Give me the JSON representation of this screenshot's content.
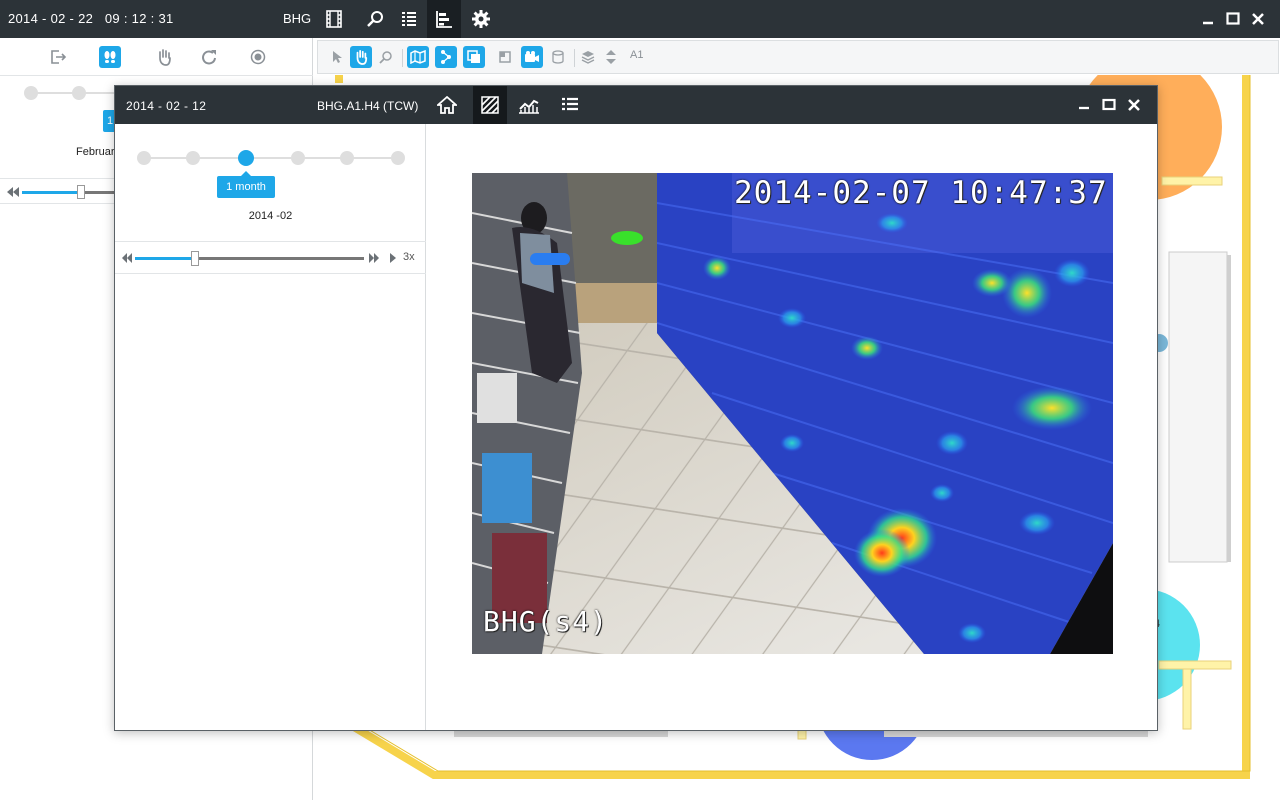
{
  "topbar": {
    "datetime": "2014 - 02 - 22   09 : 12 : 31",
    "site": "BHG",
    "icons": [
      "film-icon",
      "search-icon",
      "list-icon",
      "bar-chart-icon",
      "gear-icon"
    ],
    "window": [
      "minimize-icon",
      "maximize-icon",
      "close-icon"
    ]
  },
  "left_panel": {
    "tools": [
      "exit-icon",
      "footprints-icon",
      "hand-icon",
      "redo-icon",
      "record-icon"
    ],
    "badge_text": "1",
    "period_label": "Februar"
  },
  "map_toolbar": {
    "level_label": "A1"
  },
  "popup": {
    "date": "2014 - 02 - 12",
    "camera": "BHG.A1.H4 (TCW)",
    "icons": [
      "home-icon",
      "heatmap-icon",
      "trend-chart-icon",
      "list-icon"
    ],
    "period_badge": "1 month",
    "period_value": "2014 -02",
    "speed": "3x",
    "timeline_position": 0.26,
    "selected_range_index": 2
  },
  "video": {
    "timestamp": "2014-02-07 10:47:37",
    "camera_label": "BHG(s4)"
  },
  "floorplan": {
    "zone_label": "4"
  },
  "colors": {
    "accent": "#1ea7e8",
    "titlebar": "#2c3338",
    "wall": "#f7d34b",
    "zone_orange": "#ffae5a",
    "zone_cyan": "#5be3ef",
    "zone_blue": "#5b78f0"
  }
}
